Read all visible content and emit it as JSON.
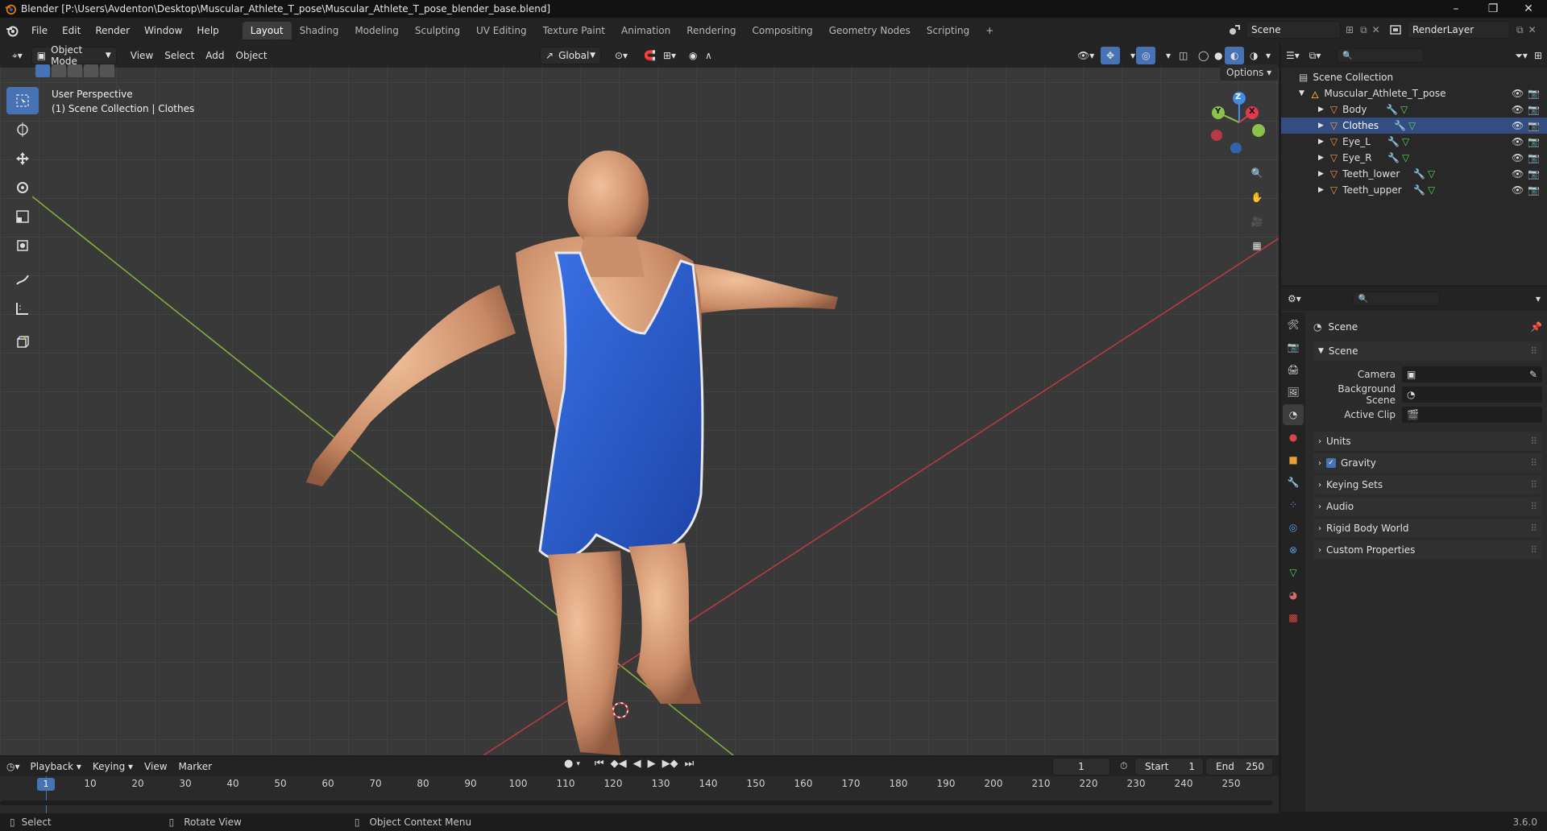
{
  "window": {
    "title": "Blender [P:\\Users\\Avdenton\\Desktop\\Muscular_Athlete_T_pose\\Muscular_Athlete_T_pose_blender_base.blend]",
    "minimize": "–",
    "maximize": "❐",
    "close": "✕"
  },
  "menu": {
    "items": [
      "File",
      "Edit",
      "Render",
      "Window",
      "Help"
    ],
    "workspaces": [
      "Layout",
      "Shading",
      "Modeling",
      "Sculpting",
      "UV Editing",
      "Texture Paint",
      "Animation",
      "Rendering",
      "Compositing",
      "Geometry Nodes",
      "Scripting"
    ],
    "active_workspace": "Layout",
    "add_workspace": "+",
    "scene": "Scene",
    "view_layer": "RenderLayer"
  },
  "viewport": {
    "mode": "Object Mode",
    "menus": [
      "View",
      "Select",
      "Add",
      "Object"
    ],
    "transform_orientation": "Global",
    "options": "Options",
    "overlay_line1": "User Perspective",
    "overlay_line2": "(1) Scene Collection | Clothes",
    "gizmo": {
      "x": "X",
      "y": "Y",
      "z": "Z"
    }
  },
  "outliner": {
    "root": "Scene Collection",
    "collection": "Muscular_Athlete_T_pose",
    "objects": [
      "Body",
      "Clothes",
      "Eye_L",
      "Eye_R",
      "Teeth_lower",
      "Teeth_upper"
    ],
    "active_object": "Clothes"
  },
  "properties": {
    "context": "Scene",
    "panel_scene": "Scene",
    "camera_label": "Camera",
    "bg_scene_label": "Background Scene",
    "active_clip_label": "Active Clip",
    "panels": [
      "Units",
      "Gravity",
      "Keying Sets",
      "Audio",
      "Rigid Body World",
      "Custom Properties"
    ],
    "gravity_checked": true
  },
  "timeline": {
    "menus": [
      "Playback",
      "Keying",
      "View",
      "Marker"
    ],
    "current_frame": "1",
    "start_label": "Start",
    "start": "1",
    "end_label": "End",
    "end": "250",
    "ticks": [
      "1",
      "10",
      "20",
      "30",
      "40",
      "50",
      "60",
      "70",
      "80",
      "90",
      "100",
      "110",
      "120",
      "130",
      "140",
      "150",
      "160",
      "170",
      "180",
      "190",
      "200",
      "210",
      "220",
      "230",
      "240",
      "250"
    ]
  },
  "statusbar": {
    "select": "Select",
    "rotate": "Rotate View",
    "context_menu": "Object Context Menu",
    "version": "3.6.0"
  },
  "colors": {
    "accent": "#4772b3",
    "x_axis": "#e2394f",
    "y_axis": "#8bc34a",
    "z_axis": "#3f8ce6",
    "object_orange": "#e8a03a",
    "skin": "#d9a07a",
    "suit": "#2b5fd4"
  }
}
